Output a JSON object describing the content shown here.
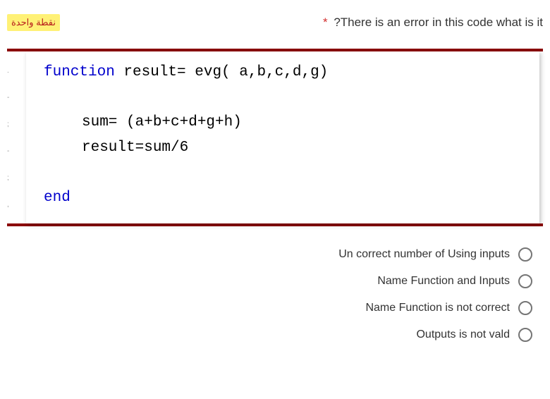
{
  "header": {
    "points_badge": "نقطة واحدة",
    "asterisk": "*",
    "question": "?There is an error in this code what is it"
  },
  "code": {
    "line1_kw": "function ",
    "line1_rest": "result= evg( a,b,c,d,g)",
    "line2": "sum= (a+b+c+d+g+h)",
    "line3": "result=sum/6",
    "line4_kw": "end"
  },
  "options": [
    "Un correct number of Using inputs",
    "Name Function and Inputs",
    "Name Function is not correct",
    "Outputs is not vald"
  ]
}
